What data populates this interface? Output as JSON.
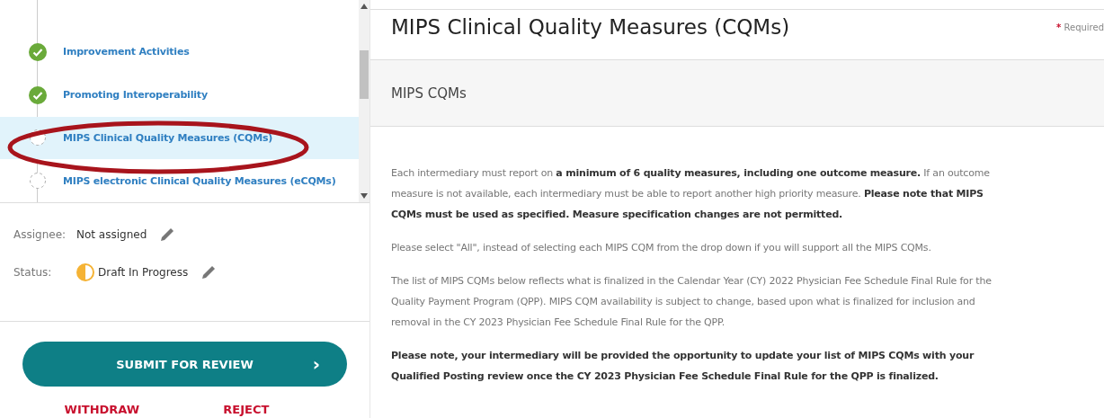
{
  "sidebar": {
    "steps": [
      {
        "label": "Improvement Activities",
        "completed": true,
        "selected": false,
        "circled": false
      },
      {
        "label": "Promoting Interoperability",
        "completed": true,
        "selected": false,
        "circled": false
      },
      {
        "label": "MIPS Clinical Quality Measures (CQMs)",
        "completed": false,
        "selected": true,
        "circled": true
      },
      {
        "label": "MIPS electronic Clinical Quality Measures (eCQMs)",
        "completed": false,
        "selected": false,
        "circled": false
      }
    ],
    "assignee": {
      "label": "Assignee:",
      "value": "Not assigned"
    },
    "status": {
      "label": "Status:",
      "value": "Draft In Progress"
    },
    "submit_button": "SUBMIT FOR REVIEW",
    "submit_arrow": "›",
    "actions": [
      "WITHDRAW",
      "REJECT"
    ]
  },
  "main": {
    "title": "MIPS Clinical Quality Measures (CQMs)",
    "required_mark": "*",
    "required_label": "Required",
    "section_title": "MIPS CQMs",
    "paragraphs": [
      "Each intermediary must report on **a minimum of 6 quality measures, including one outcome measure.** If an outcome measure is not available, each intermediary must be able to report another high priority measure. **Please note that MIPS CQMs must be used as specified. Measure specification changes are not permitted.**",
      "Please select \"All\", instead of selecting each MIPS CQM from the drop down if you will support all the MIPS CQMs.",
      "The list of MIPS CQMs below reflects what is finalized in the Calendar Year (CY) 2022 Physician Fee Schedule Final Rule for the Quality Payment Program (QPP). MIPS CQM availability is subject to change, based upon what is finalized for inclusion and removal in the CY 2023 Physician Fee Schedule Final Rule for the QPP.",
      "**Please note, your intermediary will be provided the opportunity to update your list of MIPS CQMs with your Qualified Posting review once the CY 2023 Physician Fee Schedule Final Rule for the QPP is finalized.**"
    ]
  }
}
